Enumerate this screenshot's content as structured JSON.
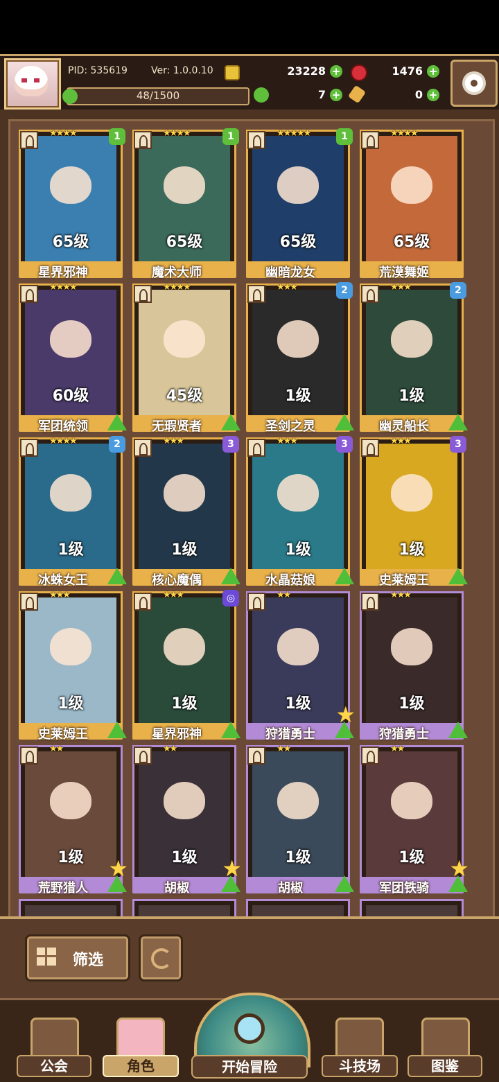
{
  "header": {
    "pid": "PID: 535619",
    "version": "Ver: 1.0.0.10",
    "gold": "23228",
    "gems": "1476",
    "energy": "48/1500",
    "clover": "7",
    "keys": "0"
  },
  "icons": {
    "settings": "gear-icon",
    "filter": "grid-icon",
    "refresh": "refresh-icon",
    "gold": "coin-icon",
    "gems": "red-gem-icon",
    "energy": "clover-icon",
    "key": "key-icon"
  },
  "colors": {
    "frame_gold": "#e8b14a",
    "frame_purple": "#b28ad6",
    "upgrade_green": "#4fbf3a",
    "badge_green": "#5fbf3b",
    "badge_blue": "#4a9be0",
    "badge_purple": "#8a5bd6"
  },
  "cards": [
    {
      "name": "星界邪神",
      "level": "65级",
      "stars": "★★★★",
      "badge": "1",
      "badge_color": "#5fbf3b",
      "rarity": "gold",
      "up": false,
      "star_btn": false,
      "art": "#3a7fb0"
    },
    {
      "name": "魔术大师",
      "level": "65级",
      "stars": "★★★★",
      "badge": "1",
      "badge_color": "#5fbf3b",
      "rarity": "gold",
      "up": false,
      "star_btn": false,
      "art": "#3b6a5a"
    },
    {
      "name": "幽暗龙女",
      "level": "65级",
      "stars": "★★★★★",
      "badge": "1",
      "badge_color": "#5fbf3b",
      "rarity": "gold",
      "up": false,
      "star_btn": false,
      "art": "#1f3f6a"
    },
    {
      "name": "荒漠舞姬",
      "level": "65级",
      "stars": "★★★★",
      "badge": "",
      "badge_color": "",
      "rarity": "gold",
      "up": false,
      "star_btn": false,
      "art": "#c46a3a"
    },
    {
      "name": "军团统领",
      "level": "60级",
      "stars": "★★★★",
      "badge": "",
      "badge_color": "",
      "rarity": "gold",
      "up": true,
      "star_btn": false,
      "art": "#4a3a6a"
    },
    {
      "name": "无瑕贤者",
      "level": "45级",
      "stars": "★★★★",
      "badge": "",
      "badge_color": "",
      "rarity": "gold",
      "up": true,
      "star_btn": false,
      "art": "#d8c69a"
    },
    {
      "name": "圣剑之灵",
      "level": "1级",
      "stars": "★★★",
      "badge": "2",
      "badge_color": "#4a9be0",
      "rarity": "gold",
      "up": true,
      "star_btn": false,
      "art": "#2a2a2a"
    },
    {
      "name": "幽灵船长",
      "level": "1级",
      "stars": "★★★",
      "badge": "2",
      "badge_color": "#4a9be0",
      "rarity": "gold",
      "up": true,
      "star_btn": false,
      "art": "#2d4a3a"
    },
    {
      "name": "冰蛛女王",
      "level": "1级",
      "stars": "★★★★",
      "badge": "2",
      "badge_color": "#4a9be0",
      "rarity": "gold",
      "up": true,
      "star_btn": false,
      "art": "#2a6a8a"
    },
    {
      "name": "核心魔偶",
      "level": "1级",
      "stars": "★★★",
      "badge": "3",
      "badge_color": "#8a5bd6",
      "rarity": "gold",
      "up": true,
      "star_btn": false,
      "art": "#22384a"
    },
    {
      "name": "水晶菇娘",
      "level": "1级",
      "stars": "★★★",
      "badge": "3",
      "badge_color": "#8a5bd6",
      "rarity": "gold",
      "up": true,
      "star_btn": false,
      "art": "#2a7a8a"
    },
    {
      "name": "史莱姆王",
      "level": "1级",
      "stars": "★★★",
      "badge": "3",
      "badge_color": "#8a5bd6",
      "rarity": "gold",
      "up": true,
      "star_btn": false,
      "art": "#d8a820"
    },
    {
      "name": "史莱姆王",
      "level": "1级",
      "stars": "★★★",
      "badge": "",
      "badge_color": "",
      "rarity": "gold",
      "up": true,
      "star_btn": false,
      "art": "#9ab8c8"
    },
    {
      "name": "星界邪神",
      "level": "1级",
      "stars": "★★★",
      "badge": "◎",
      "badge_color": "#6a4ad6",
      "rarity": "gold",
      "up": true,
      "star_btn": false,
      "art": "#2a4a3a"
    },
    {
      "name": "狩猎勇士",
      "level": "1级",
      "stars": "★★",
      "badge": "",
      "badge_color": "",
      "rarity": "purple",
      "up": true,
      "star_btn": true,
      "art": "#3a3a5a"
    },
    {
      "name": "狩猎勇士",
      "level": "1级",
      "stars": "★★★",
      "badge": "",
      "badge_color": "",
      "rarity": "purple",
      "up": true,
      "star_btn": false,
      "art": "#3a2a2a"
    },
    {
      "name": "荒野猎人",
      "level": "1级",
      "stars": "★★",
      "badge": "",
      "badge_color": "",
      "rarity": "purple",
      "up": true,
      "star_btn": true,
      "art": "#6a4a3a"
    },
    {
      "name": "胡椒",
      "level": "1级",
      "stars": "★★",
      "badge": "",
      "badge_color": "",
      "rarity": "purple",
      "up": true,
      "star_btn": true,
      "art": "#3a3038"
    },
    {
      "name": "胡椒",
      "level": "1级",
      "stars": "★★",
      "badge": "",
      "badge_color": "",
      "rarity": "purple",
      "up": true,
      "star_btn": false,
      "art": "#3a4a5a"
    },
    {
      "name": "军团铁骑",
      "level": "1级",
      "stars": "★★",
      "badge": "",
      "badge_color": "",
      "rarity": "purple",
      "up": true,
      "star_btn": true,
      "art": "#5a3a3a"
    }
  ],
  "toolbar": {
    "filter_label": "筛选"
  },
  "nav": {
    "guild": "公会",
    "character": "角色",
    "adventure": "开始冒险",
    "arena": "斗技场",
    "codex": "图鉴"
  }
}
